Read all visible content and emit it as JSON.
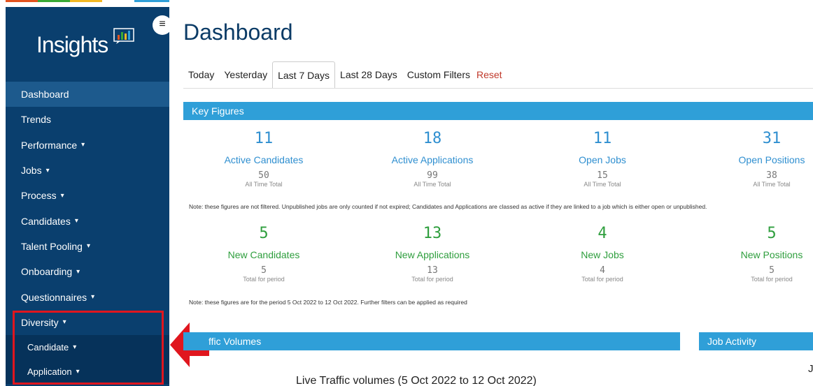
{
  "colors": {
    "sidebar": "#0a3f6e",
    "accent": "#2f9fd8",
    "green": "#2e9e3d",
    "highlight": "#e0161e",
    "strip": [
      "#e2531f",
      "#39a935",
      "#f3b823",
      "#ffffff",
      "#2f9fd8"
    ]
  },
  "sidebar": {
    "logo_text": "Insights",
    "items": [
      {
        "label": "Dashboard",
        "caret": false
      },
      {
        "label": "Trends",
        "caret": false
      },
      {
        "label": "Performance",
        "caret": true
      },
      {
        "label": "Jobs",
        "caret": true
      },
      {
        "label": "Process",
        "caret": true
      },
      {
        "label": "Candidates",
        "caret": true
      },
      {
        "label": "Talent Pooling",
        "caret": true
      },
      {
        "label": "Onboarding",
        "caret": true
      },
      {
        "label": "Questionnaires",
        "caret": true
      },
      {
        "label": "Diversity",
        "caret": true
      }
    ],
    "subitems": [
      {
        "label": "Candidate",
        "caret": true
      },
      {
        "label": "Application",
        "caret": true
      }
    ],
    "caret_glyph": "▾"
  },
  "header": {
    "menu_icon": "≡",
    "title": "Dashboard"
  },
  "tabs": [
    "Today",
    "Yesterday",
    "Last 7 Days",
    "Last 28 Days",
    "Custom Filters"
  ],
  "active_tab": "Last 7 Days",
  "reset_label": "Reset",
  "key_figures": {
    "header": "Key Figures",
    "active": [
      {
        "value": "11",
        "label": "Active Candidates",
        "total": "50",
        "total_label": "All Time Total"
      },
      {
        "value": "18",
        "label": "Active Applications",
        "total": "99",
        "total_label": "All Time Total"
      },
      {
        "value": "11",
        "label": "Open Jobs",
        "total": "15",
        "total_label": "All Time Total"
      },
      {
        "value": "31",
        "label": "Open Positions",
        "total": "38",
        "total_label": "All Time Total"
      }
    ],
    "note1": "Note: these figures are not filtered. Unpublished jobs are only counted if not expired; Candidates and Applications are classed as active if they are linked to a job which is either open or unpublished.",
    "new": [
      {
        "value": "5",
        "label": "New Candidates",
        "total": "5",
        "total_label": "Total for period"
      },
      {
        "value": "13",
        "label": "New Applications",
        "total": "13",
        "total_label": "Total for period"
      },
      {
        "value": "4",
        "label": "New Jobs",
        "total": "4",
        "total_label": "Total for period"
      },
      {
        "value": "5",
        "label": "New Positions",
        "total": "5",
        "total_label": "Total for period"
      }
    ],
    "note2": "Note: these figures are for the period 5 Oct 2022 to 12 Oct 2022. Further filters can be applied as required"
  },
  "traffic": {
    "header": "ffic Volumes",
    "chart_title": "Live Traffic volumes (5 Oct 2022 to 12 Oct 2022)"
  },
  "job_activity": {
    "header": "Job Activity",
    "partial_text": "J"
  }
}
